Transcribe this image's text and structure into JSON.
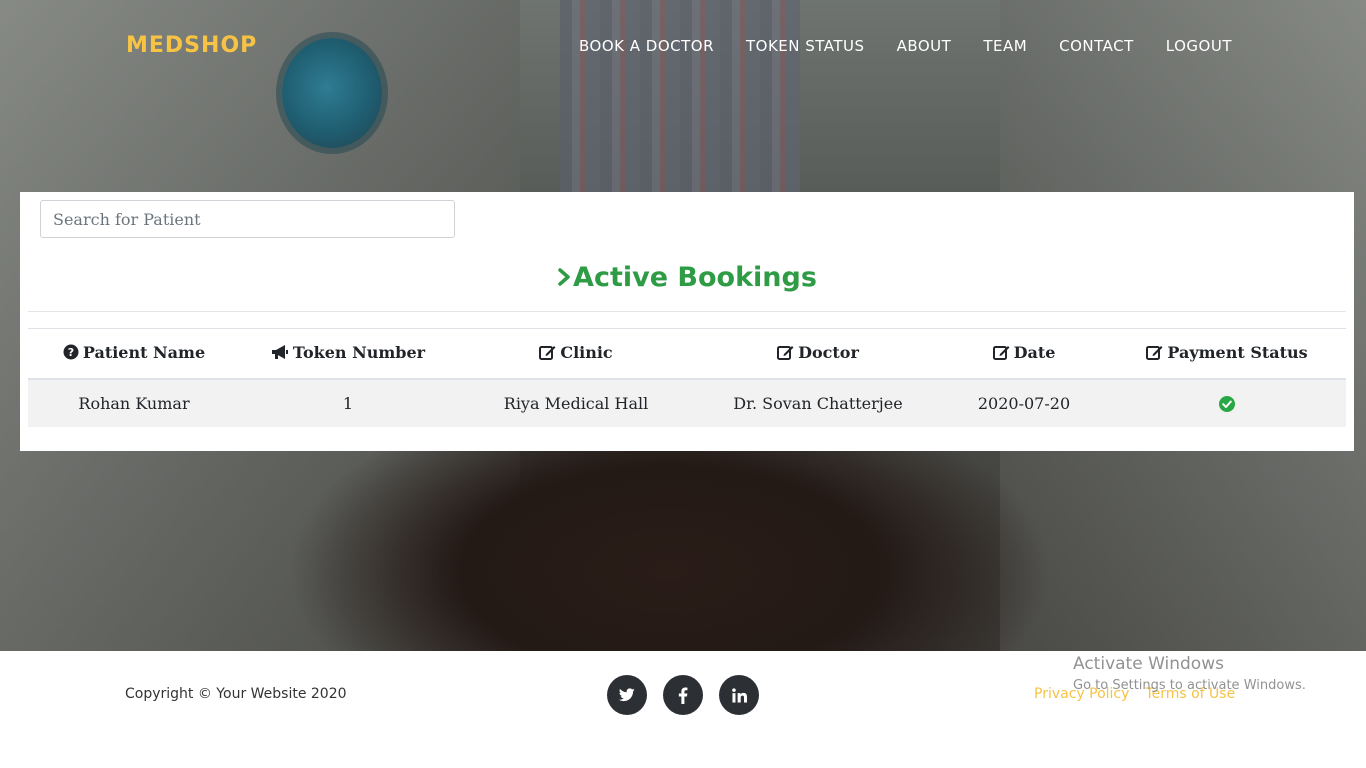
{
  "navbar": {
    "brand": "MEDSHOP",
    "links": [
      "BOOK A DOCTOR",
      "TOKEN STATUS",
      "ABOUT",
      "TEAM",
      "CONTACT",
      "LOGOUT"
    ]
  },
  "search": {
    "placeholder": "Search for Patient"
  },
  "section": {
    "title": "Active Bookings"
  },
  "table": {
    "columns": [
      "Patient Name",
      "Token Number",
      "Clinic",
      "Doctor",
      "Date",
      "Payment Status"
    ],
    "rows": [
      {
        "patient_name": "Rohan Kumar",
        "token_number": "1",
        "clinic": "Riya Medical Hall",
        "doctor": "Dr. Sovan Chatterjee",
        "date": "2020-07-20",
        "payment_status_icon": "check-circle-icon"
      }
    ]
  },
  "footer": {
    "copyright": "Copyright © Your Website 2020",
    "social": [
      "twitter-icon",
      "facebook-icon",
      "linkedin-icon"
    ],
    "links": [
      "Privacy Policy",
      "Terms of Use"
    ]
  },
  "watermark": {
    "title": "Activate Windows",
    "subtitle": "Go to Settings to activate Windows."
  },
  "colors": {
    "brand": "#f6c344",
    "heading": "#2e9b45",
    "success": "#28a745"
  }
}
